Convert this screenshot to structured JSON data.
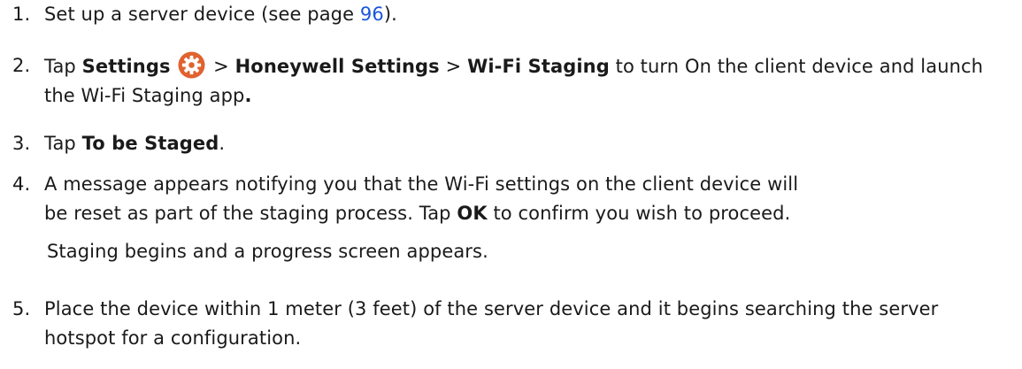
{
  "steps": [
    {
      "number": "1.",
      "text_before": "Set up a server device (see page ",
      "link": "96",
      "text_after": ")."
    },
    {
      "number": "2.",
      "tap": "Tap",
      "settings": "Settings",
      "gt1": ">",
      "honeywell": "Honeywell Settings",
      "gt2": ">",
      "wifi": "Wi-Fi Staging",
      "rest": " to turn On the client device and launch the Wi-Fi Staging app",
      "end": "."
    },
    {
      "number": "3.",
      "tap": "Tap ",
      "bold": "To be Staged",
      "end": "."
    },
    {
      "number": "4.",
      "line1": "A message appears notifying you that the Wi-Fi settings on the client device will",
      "line2_before": "be reset as part of the staging process. Tap ",
      "ok": "OK",
      "line2_after": " to confirm you wish to proceed."
    },
    {
      "number": "5.",
      "text": "Place the device within 1 meter (3 feet) of the server device and it begins searching the server hotspot for a configuration."
    }
  ],
  "note": "Staging begins and a progress screen appears.",
  "colors": {
    "link": "#1a56db",
    "gear_bg": "#e0622f",
    "gear_fg": "#ffffff"
  },
  "icons": {
    "settings": "gear-icon"
  }
}
